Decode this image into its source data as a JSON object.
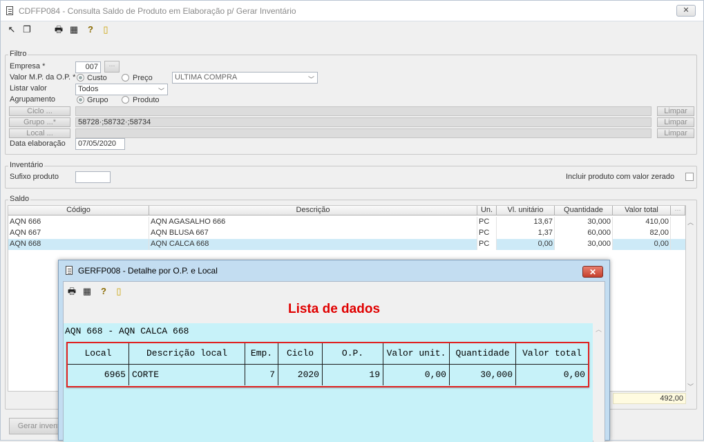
{
  "main_window": {
    "title": "CDFFP084 - Consulta Saldo de Produto em Elaboração p/ Gerar Inventário",
    "close_label": "✕"
  },
  "filtro": {
    "legend": "Filtro",
    "empresa_label": "Empresa *",
    "empresa_value": "007",
    "valor_label": "Valor M.P. da O.P. *",
    "custo_label": "Custo",
    "preco_label": "Preço",
    "preco_option": "ULTIMA COMPRA",
    "listar_label": "Listar valor",
    "listar_value": "Todos",
    "agrupamento_label": "Agrupamento",
    "grupo_label": "Grupo",
    "produto_label": "Produto",
    "ciclo_button": "Ciclo ...",
    "grupo_button": "Grupo ...*",
    "grupo_value": "58728·;58732·;58734",
    "local_button": "Local ...",
    "limpar_label": "Limpar",
    "data_label": "Data elaboração",
    "data_value": "07/05/2020"
  },
  "inventario": {
    "legend": "Inventário",
    "sufixo_label": "Sufixo produto",
    "incluir_label": "Incluir produto com valor zerado"
  },
  "saldo": {
    "legend": "Saldo",
    "headers": [
      "Código",
      "Descrição",
      "Un.",
      "Vl. unitário",
      "Quantidade",
      "Valor total"
    ],
    "rows": [
      {
        "codigo": "AQN 666",
        "descricao": "AQN AGASALHO 666",
        "un": "PC",
        "vl_unit": "13,67",
        "quantidade": "30,000",
        "valor_total": "410,00"
      },
      {
        "codigo": "AQN 667",
        "descricao": "AQN BLUSA 667",
        "un": "PC",
        "vl_unit": "1,37",
        "quantidade": "60,000",
        "valor_total": "82,00"
      },
      {
        "codigo": "AQN 668",
        "descricao": "AQN CALCA 668",
        "un": "PC",
        "vl_unit": "0,00",
        "quantidade": "30,000",
        "valor_total": "0,00"
      }
    ],
    "total": "492,00",
    "gerar_button": "Gerar invent"
  },
  "popup": {
    "title": "GERFP008 - Detalhe por O.P. e Local",
    "close_label": "✕",
    "heading": "Lista de dados",
    "product_line": "AQN 668 - AQN CALCA 668",
    "headers": [
      "Local",
      "Descrição local",
      "Emp.",
      "Ciclo",
      "O.P.",
      "Valor unit.",
      "Quantidade",
      "Valor total"
    ],
    "row": {
      "local": "6965",
      "descricao": "CORTE",
      "emp": "7",
      "ciclo": "2020",
      "op": "19",
      "valor_unit": "0,00",
      "quantidade": "30,000",
      "valor_total": "0,00"
    }
  },
  "colors": {
    "selected_row": "#cdeaf7",
    "popup_cyan": "#c7f2f9",
    "heading_red": "#e00000",
    "highlight_border": "#e02020"
  }
}
